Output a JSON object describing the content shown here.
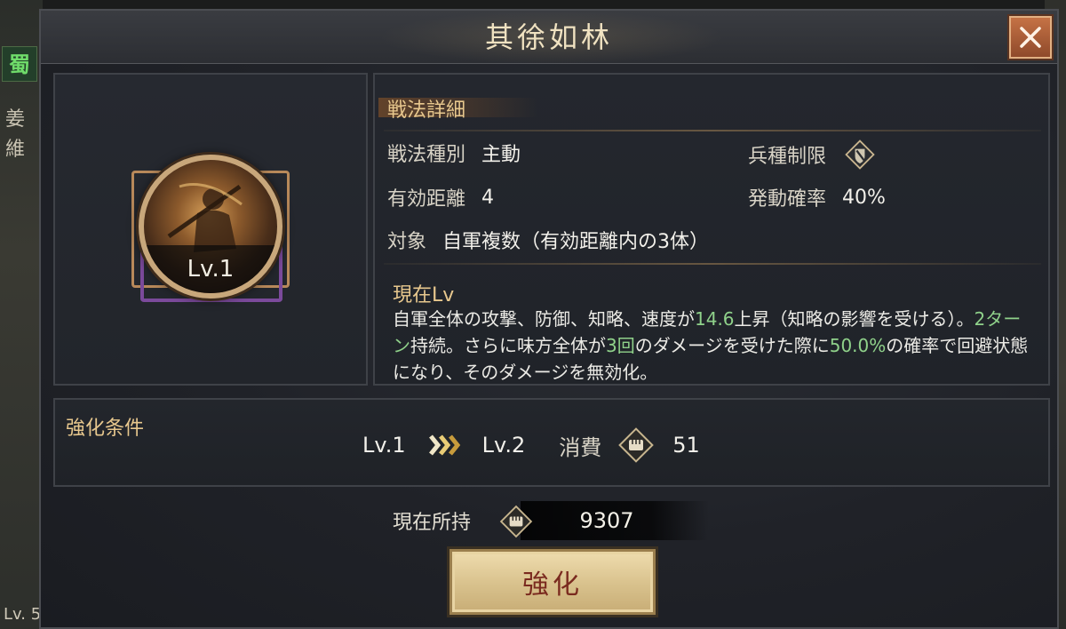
{
  "background": {
    "faction_badge": "蜀",
    "side_name_chars": [
      "姜",
      "維"
    ],
    "bottom_lv": "Lv. 5"
  },
  "dialog": {
    "title": "其徐如林",
    "close_icon": "close-x-icon"
  },
  "skill": {
    "level_badge": "Lv.1",
    "icon": "warrior-skill-icon"
  },
  "details": {
    "section_title": "戦法詳細",
    "type_label": "戦法種別",
    "type_value": "主動",
    "troop_limit_label": "兵種制限",
    "troop_limit_icon": "shield-diamond-icon",
    "range_label": "有効距離",
    "range_value": "4",
    "chance_label": "発動確率",
    "chance_value": "40%",
    "target_label": "対象",
    "target_value": "自軍複数（有効距離内の3体）",
    "current_lv_title": "現在Lv",
    "description": {
      "p1": "自軍全体の攻撃、防御、知略、速度が",
      "h1": "14.6",
      "p2": "上昇（知略の影響を受ける）。",
      "h2": "2ターン",
      "p3": "持続。さらに味方全体が",
      "h3": "3回",
      "p4": "のダメージを受けた際に",
      "h4": "50.0%",
      "p5": "の確率で回避状態になり、そのダメージを無効化。"
    },
    "highlight_color": "#8fd18a"
  },
  "enhance": {
    "section_title": "強化条件",
    "from_level": "Lv.1",
    "arrow_icon": "triple-chevron-right-icon",
    "to_level": "Lv.2",
    "cost_label": "消費",
    "cost_icon": "fist-scroll-icon",
    "cost_value": "51"
  },
  "footer": {
    "owned_label": "現在所持",
    "owned_icon": "fist-scroll-icon",
    "owned_value": "9307",
    "enhance_button": "強化"
  },
  "colors": {
    "gold_text": "#e8c88e",
    "highlight_green": "#8fd18a",
    "button_text": "#7a2a1f",
    "close_button": "#c57245"
  }
}
